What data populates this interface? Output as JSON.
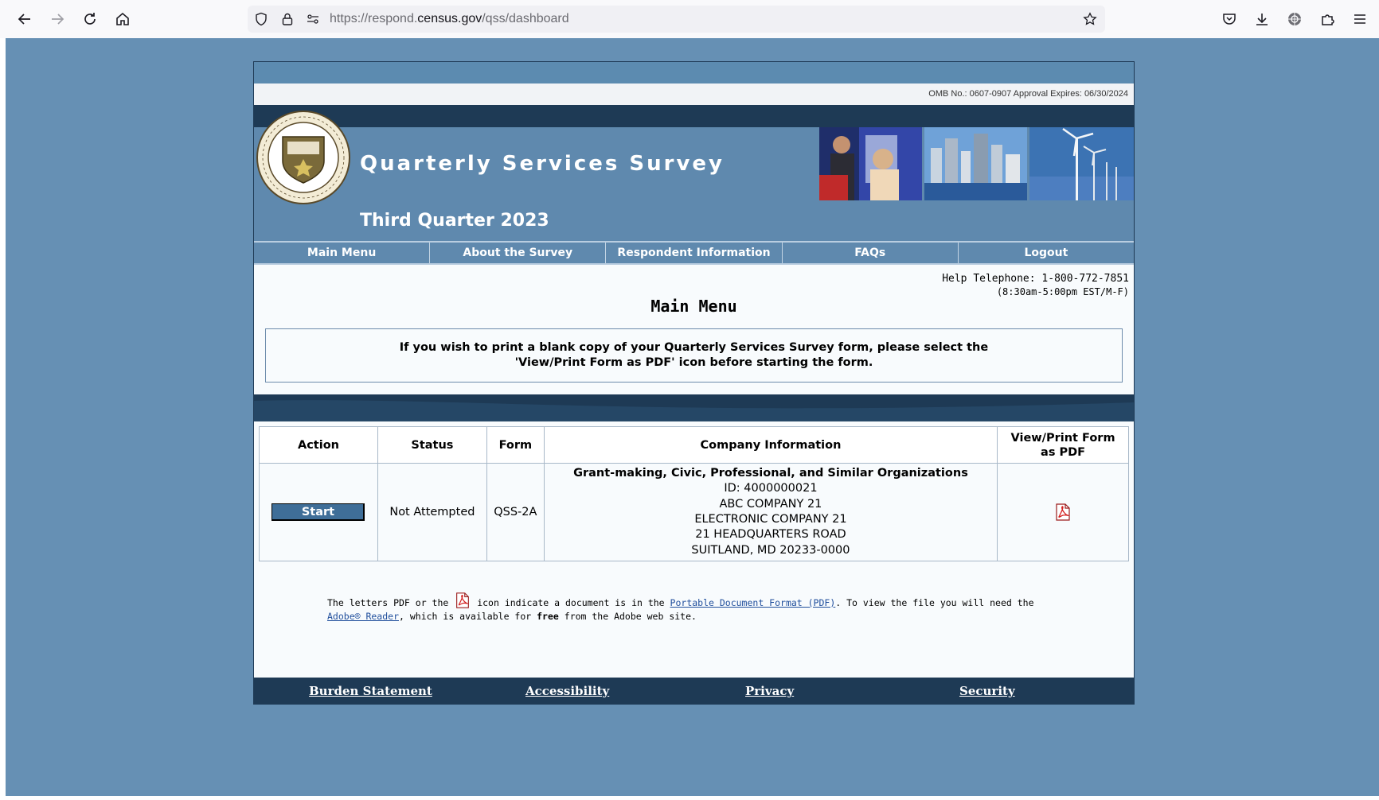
{
  "browser": {
    "url_prefix": "https://respond.",
    "url_domain": "census.gov",
    "url_path": "/qss/dashboard"
  },
  "header": {
    "omb": "OMB No.: 0607-0907 Approval Expires: 06/30/2024",
    "title": "Quarterly Services Survey",
    "quarter": "Third Quarter 2023"
  },
  "nav": [
    "Main Menu",
    "About the Survey",
    "Respondent Information",
    "FAQs",
    "Logout"
  ],
  "help": {
    "telephone": "Help Telephone: 1-800-772-7851",
    "hours": "(8:30am-5:00pm EST/M-F)"
  },
  "main": {
    "heading": "Main Menu",
    "notice_line1": "If you wish to print a blank copy of your Quarterly Services Survey form, please select the",
    "notice_line2": "'View/Print Form as PDF' icon before starting the form."
  },
  "table": {
    "headers": {
      "action": "Action",
      "status": "Status",
      "form": "Form",
      "company": "Company Information",
      "view_line1": "View/Print Form",
      "view_line2": "as PDF"
    },
    "row": {
      "action_label": "Start",
      "status": "Not Attempted",
      "form": "QSS-2A",
      "company_name": "Grant-making, Civic, Professional, and Similar Organizations",
      "id": "ID: 4000000021",
      "line1": "ABC COMPANY 21",
      "line2": "ELECTRONIC COMPANY 21",
      "line3": "21 HEADQUARTERS ROAD",
      "line4": "SUITLAND, MD 20233-0000"
    }
  },
  "footnote": {
    "part1": "The letters PDF or the",
    "part2": "icon indicate a document is in the",
    "link_pdf": "Portable Document Format (PDF)",
    "part3": ". To view the file you will need the",
    "link_adobe": "Adobe® Reader",
    "part4": ", which is available for",
    "bold_free": "free",
    "part5": "from the Adobe web site."
  },
  "footer": [
    "Burden Statement",
    "Accessibility",
    "Privacy",
    "Security"
  ],
  "colors": {
    "page_bg": "#6690b4",
    "banner": "#5f89ae",
    "dark_band": "#1e3a55",
    "button": "#3f6e98",
    "link": "#1f4e9c"
  },
  "icons": [
    "back-arrow-icon",
    "forward-arrow-icon",
    "reload-icon",
    "home-icon",
    "shield-icon",
    "lock-icon",
    "permissions-icon",
    "bookmark-star-icon",
    "pocket-icon",
    "download-icon",
    "account-icon",
    "extensions-icon",
    "menu-icon",
    "pdf-icon"
  ]
}
